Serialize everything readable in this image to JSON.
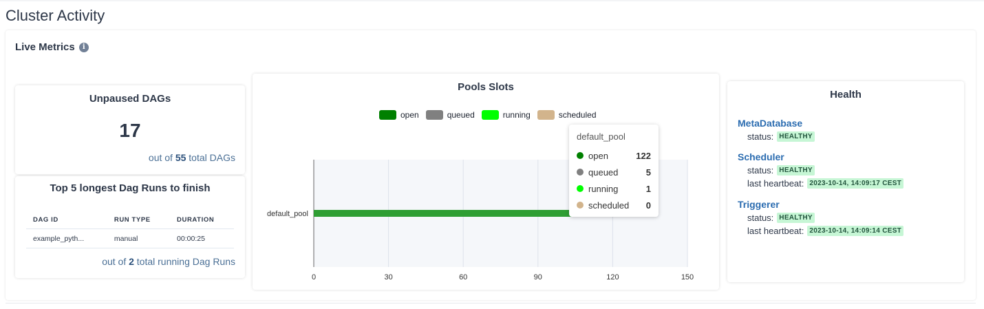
{
  "page": {
    "title": "Cluster Activity"
  },
  "live_metrics": {
    "title": "Live Metrics",
    "info_icon": "info-circle-icon"
  },
  "unpaused": {
    "title": "Unpaused DAGs",
    "count": "17",
    "sub_prefix": "out of",
    "total": "55",
    "sub_suffix": "total DAGs"
  },
  "top5": {
    "title": "Top 5 longest Dag Runs to finish",
    "columns": [
      "DAG ID",
      "RUN TYPE",
      "DURATION"
    ],
    "rows": [
      {
        "dag_id": "example_pyth...",
        "run_type": "manual",
        "duration": "00:00:25"
      }
    ],
    "sub_prefix": "out of",
    "total": "2",
    "sub_suffix": "total running Dag Runs"
  },
  "pools": {
    "title": "Pools Slots",
    "tooltip": {
      "title": "default_pool",
      "rows": [
        {
          "label": "open",
          "value": "122",
          "color": "#008000"
        },
        {
          "label": "queued",
          "value": "5",
          "color": "#808080"
        },
        {
          "label": "running",
          "value": "1",
          "color": "#00ff00"
        },
        {
          "label": "scheduled",
          "value": "0",
          "color": "#d2b48c"
        }
      ]
    }
  },
  "chart_data": {
    "type": "bar",
    "orientation": "horizontal",
    "stacked": true,
    "title": "Pools Slots",
    "categories": [
      "default_pool"
    ],
    "series": [
      {
        "name": "open",
        "values": [
          122
        ],
        "color": "#008000"
      },
      {
        "name": "queued",
        "values": [
          5
        ],
        "color": "#808080"
      },
      {
        "name": "running",
        "values": [
          1
        ],
        "color": "#00ff00"
      },
      {
        "name": "scheduled",
        "values": [
          0
        ],
        "color": "#d2b48c"
      }
    ],
    "xlim": [
      0,
      150
    ],
    "xticks": [
      "0",
      "30",
      "60",
      "90",
      "120",
      "150"
    ],
    "grid": true,
    "legend": "top-center"
  },
  "health": {
    "title": "Health",
    "components": [
      {
        "name": "MetaDatabase",
        "status_label": "status:",
        "status": "HEALTHY"
      },
      {
        "name": "Scheduler",
        "status_label": "status:",
        "status": "HEALTHY",
        "heartbeat_label": "last heartbeat:",
        "heartbeat": "2023-10-14, 14:09:17 CEST"
      },
      {
        "name": "Triggerer",
        "status_label": "status:",
        "status": "HEALTHY",
        "heartbeat_label": "last heartbeat:",
        "heartbeat": "2023-10-14, 14:09:14 CEST"
      }
    ]
  }
}
